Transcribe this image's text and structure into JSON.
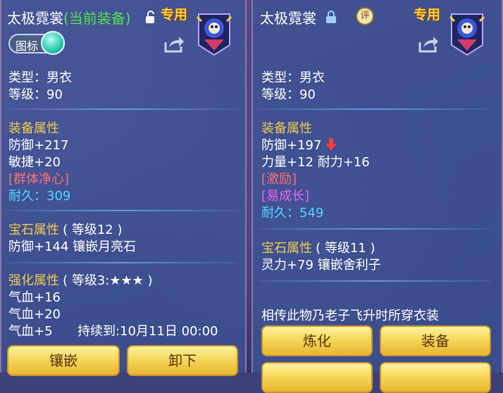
{
  "colors": {
    "panel": "#3e5496",
    "attr_header": "#f2c94c",
    "special_red": "#ff6e6e",
    "special_pink": "#f05ef0",
    "durability": "#4fd8ff",
    "equipped_green": "#54e04c",
    "button": "#f6d75a"
  },
  "left": {
    "title": "太极霓裳",
    "equipped_tag": "(当前装备)",
    "exclusive": "专用",
    "icon_toggle_label": "图标",
    "type": "类型：男衣",
    "level": "等级：90",
    "equip_attr_header": "装备属性",
    "attrs": [
      "防御+217",
      "敏捷+20"
    ],
    "special": "[群体净心]",
    "durability_label": "耐久：",
    "durability_value": "309",
    "gem_header": "宝石属性",
    "gem_level": "( 等级12 )",
    "gem_effect": "防御+144 镶嵌月亮石",
    "enhance_header": "强化属性",
    "enhance_level": "( 等级3:★★★ )",
    "enhance_lines": [
      "气血+16",
      "气血+20",
      "气血+5"
    ],
    "duration": "持续到:10月11日 00:00",
    "buttons": [
      "镶嵌",
      "卸下"
    ]
  },
  "right": {
    "title": "太极霓裳",
    "exclusive": "专用",
    "rate_badge": "评",
    "type": "类型：男衣",
    "level": "等级：90",
    "equip_attr_header": "装备属性",
    "attr_defense": "防御+197",
    "attr_line2": "力量+12 耐力+16",
    "special1": "[激励]",
    "special2": "[易成长]",
    "durability_label": "耐久：",
    "durability_value": "549",
    "gem_header": "宝石属性",
    "gem_level": "( 等级11 )",
    "gem_effect": "灵力+79 镶嵌舍利子",
    "description": "相传此物乃老子飞升时所穿衣装",
    "buttons": [
      "炼化",
      "装备"
    ]
  },
  "icons": {
    "lock_open": "lock-open-icon",
    "lock_closed": "lock-closed-icon",
    "share": "share-icon",
    "down_arrow": "down-arrow-icon",
    "emblem": "outfit-emblem-icon"
  }
}
